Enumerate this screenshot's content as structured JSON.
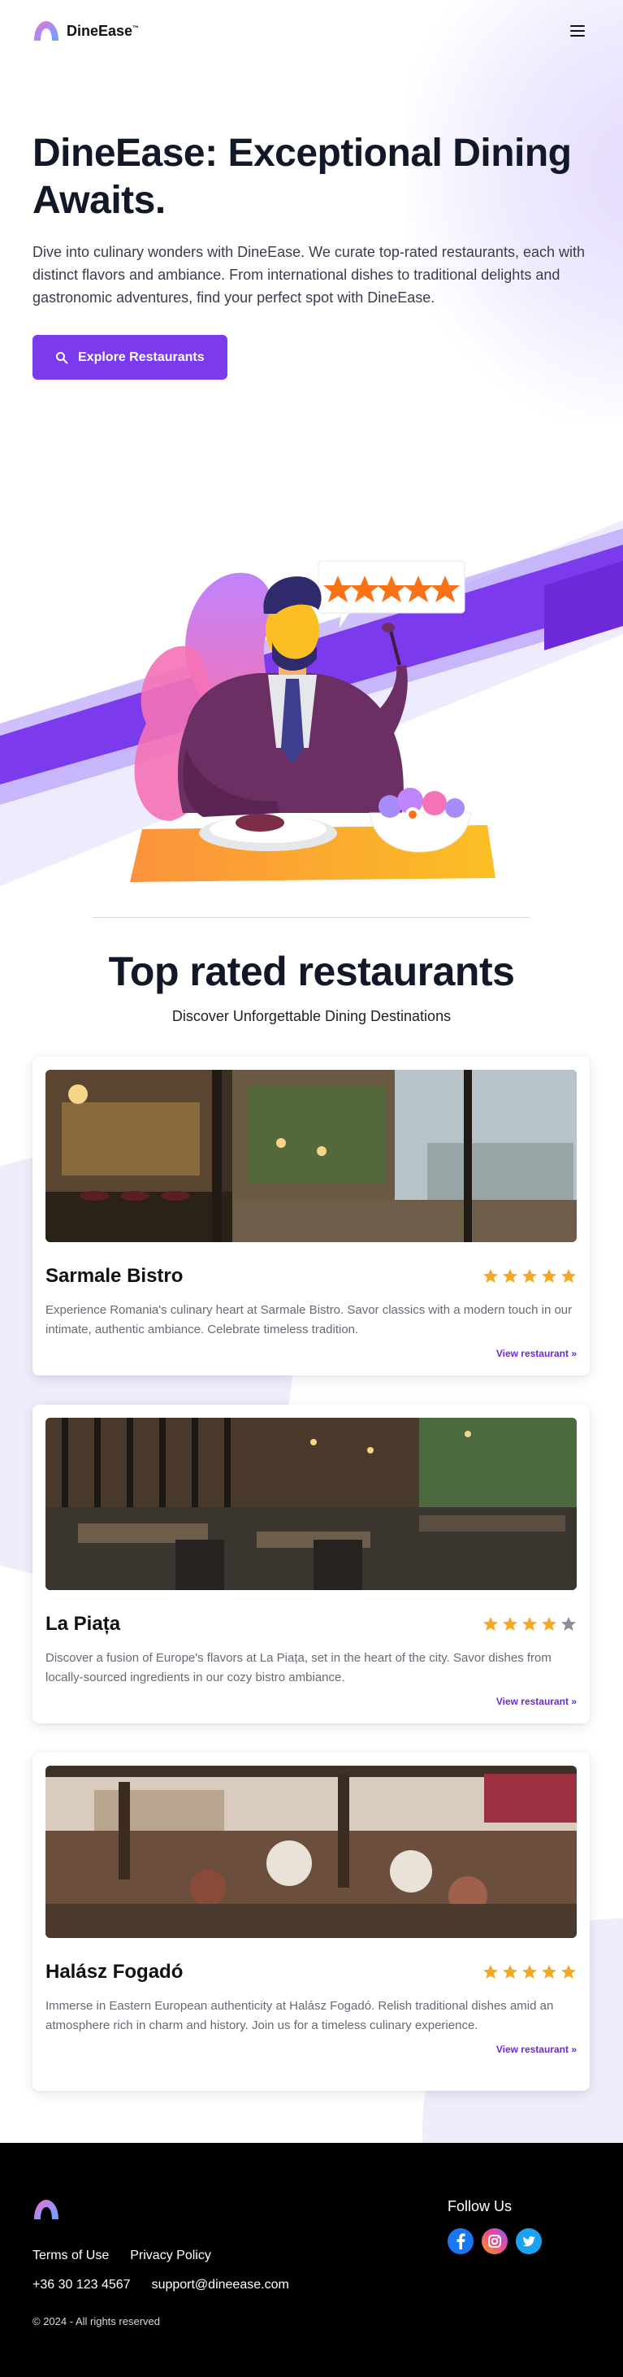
{
  "brand": {
    "name": "DineEase",
    "trademark": "™"
  },
  "header": {
    "menu_icon": "hamburger-menu-icon"
  },
  "hero": {
    "title": "DineEase: Exceptional Dining Awaits.",
    "description": "Dive into culinary wonders with DineEase. We curate top-rated restaurants, each with distinct flavors and ambiance. From international dishes to traditional delights and gastronomic adventures, find your perfect spot with DineEase.",
    "cta_label": "Explore Restaurants",
    "cta_icon": "search-icon"
  },
  "section": {
    "title": "Top rated restaurants",
    "subtitle": "Discover Unforgettable Dining Destinations"
  },
  "restaurants": [
    {
      "name": "Sarmale Bistro",
      "rating": 5,
      "description": "Experience Romania's culinary heart at Sarmale Bistro. Savor classics with a modern touch in our intimate, authentic ambiance. Celebrate timeless tradition.",
      "link": "View restaurant »"
    },
    {
      "name": "La Piața",
      "rating": 4,
      "description": "Discover a fusion of Europe's flavors at La Piața, set in the heart of the city. Savor dishes from locally-sourced ingredients in our cozy bistro ambiance.",
      "link": "View restaurant »"
    },
    {
      "name": "Halász Fogadó",
      "rating": 5,
      "description": "Immerse in Eastern European authenticity at Halász Fogadó. Relish traditional dishes amid an atmosphere rich in charm and history. Join us for a timeless culinary experience.",
      "link": "View restaurant »"
    }
  ],
  "footer": {
    "links": [
      "Terms of Use",
      "Privacy Policy"
    ],
    "phone": "+36 30 123 4567",
    "email": "support@dineease.com",
    "copyright": "© 2024 - All rights reserved",
    "follow_title": "Follow Us",
    "socials": [
      "facebook-icon",
      "instagram-icon",
      "twitter-icon"
    ]
  },
  "colors": {
    "accent": "#7c3aed",
    "star_filled": "#f5a623",
    "star_empty": "#8b8d98",
    "footer_bg": "#000000"
  }
}
